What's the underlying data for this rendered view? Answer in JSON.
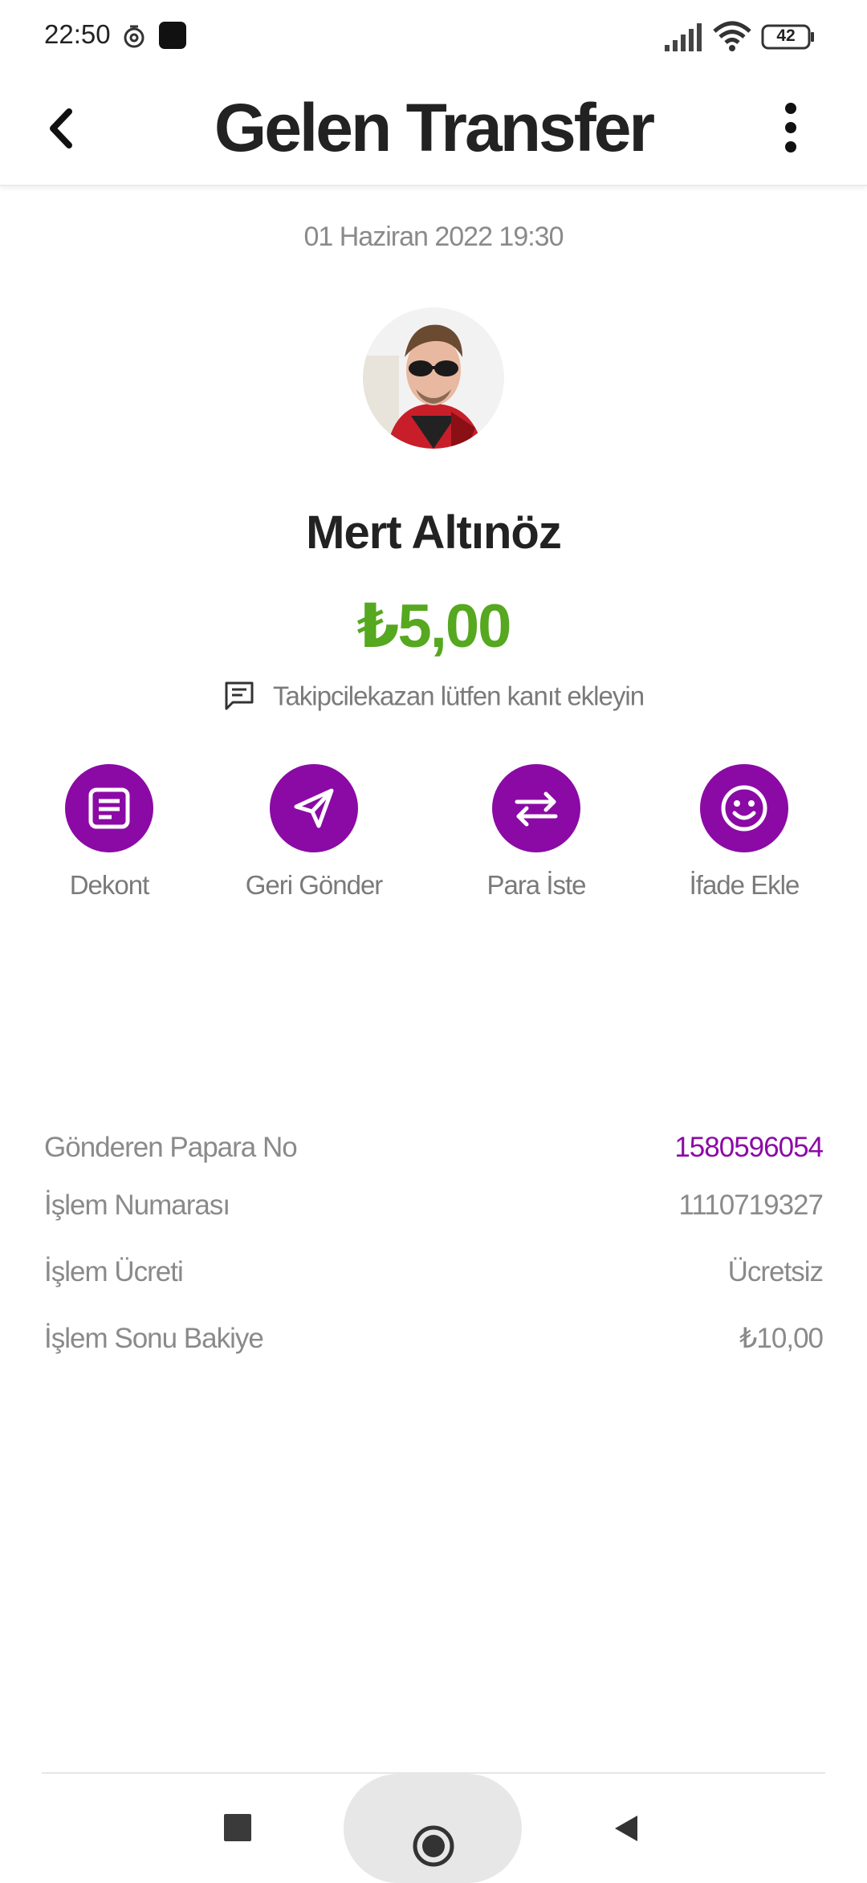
{
  "status_bar": {
    "time": "22:50",
    "battery": "42",
    "icons": [
      "sync-icon",
      "app-icon",
      "signal-icon",
      "wifi-icon",
      "battery-icon"
    ]
  },
  "app_bar": {
    "title": "Gelen Transfer",
    "back_icon": "chevron-left-icon",
    "more_icon": "more-vertical-icon"
  },
  "transfer": {
    "date": "01 Haziran 2022 19:30",
    "sender_name": "Mert Altınöz",
    "amount": "₺5,00",
    "note": "Takipcilekazan lütfen kanıt ekleyin",
    "note_icon": "message-icon"
  },
  "actions": [
    {
      "label": "Dekont",
      "icon": "receipt-icon"
    },
    {
      "label": "Geri Gönder",
      "icon": "send-icon"
    },
    {
      "label": "Para İste",
      "icon": "swap-arrows-icon"
    },
    {
      "label": "İfade Ekle",
      "icon": "smiley-icon"
    }
  ],
  "details": [
    {
      "key": "Gönderen Papara No",
      "value": "1580596054"
    },
    {
      "key": "İşlem Numarası",
      "value": "1110719327"
    },
    {
      "key": "İşlem Ücreti",
      "value": "Ücretsiz"
    },
    {
      "key": "İşlem Sonu Bakiye",
      "value": "₺10,00"
    }
  ],
  "colors": {
    "accent": "#8b0aa5",
    "amount": "#55a81f",
    "muted_text": "#8a8a8a",
    "title_text": "#222222"
  }
}
